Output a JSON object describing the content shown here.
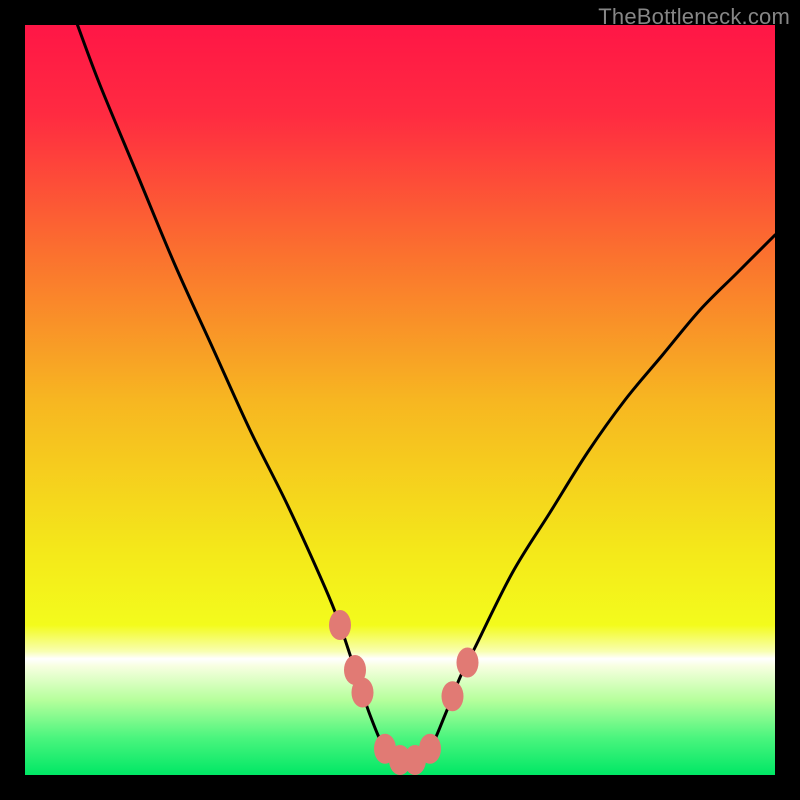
{
  "watermark": "TheBottleneck.com",
  "chart_data": {
    "type": "line",
    "title": "",
    "xlabel": "",
    "ylabel": "",
    "xlim": [
      0,
      100
    ],
    "ylim": [
      0,
      100
    ],
    "series": [
      {
        "name": "bottleneck-curve",
        "x": [
          7,
          10,
          15,
          20,
          25,
          30,
          35,
          40,
          42,
          44,
          46,
          48,
          50,
          52,
          54,
          56,
          58,
          60,
          65,
          70,
          75,
          80,
          85,
          90,
          95,
          100
        ],
        "y": [
          100,
          92,
          80,
          68,
          57,
          46,
          36,
          25,
          20,
          14,
          8,
          3.5,
          2,
          2,
          3.5,
          8,
          13,
          17,
          27,
          35,
          43,
          50,
          56,
          62,
          67,
          72
        ]
      }
    ],
    "markers": {
      "name": "highlight-dots",
      "color": "#e17a74",
      "points": [
        {
          "x": 42.0,
          "y": 20.0
        },
        {
          "x": 44.0,
          "y": 14.0
        },
        {
          "x": 45.0,
          "y": 11.0
        },
        {
          "x": 48.0,
          "y": 3.5
        },
        {
          "x": 50.0,
          "y": 2.0
        },
        {
          "x": 52.0,
          "y": 2.0
        },
        {
          "x": 54.0,
          "y": 3.5
        },
        {
          "x": 57.0,
          "y": 10.5
        },
        {
          "x": 59.0,
          "y": 15.0
        }
      ]
    },
    "gradient_stops": [
      {
        "offset": 0.0,
        "color": "#ff1646"
      },
      {
        "offset": 0.12,
        "color": "#ff2b41"
      },
      {
        "offset": 0.3,
        "color": "#fb6f2f"
      },
      {
        "offset": 0.5,
        "color": "#f7b621"
      },
      {
        "offset": 0.7,
        "color": "#f4e81a"
      },
      {
        "offset": 0.8,
        "color": "#f3fb1c"
      },
      {
        "offset": 0.835,
        "color": "#f8ffb0"
      },
      {
        "offset": 0.845,
        "color": "#ffffff"
      },
      {
        "offset": 0.855,
        "color": "#f7ffe0"
      },
      {
        "offset": 0.9,
        "color": "#b6ff9c"
      },
      {
        "offset": 0.95,
        "color": "#4bf57e"
      },
      {
        "offset": 1.0,
        "color": "#00e765"
      }
    ]
  }
}
